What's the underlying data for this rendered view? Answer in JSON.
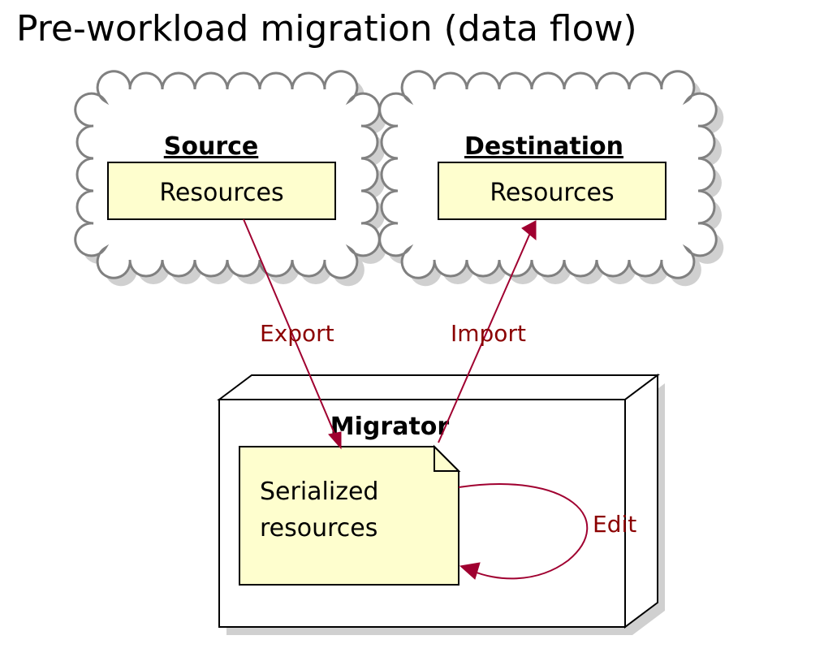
{
  "title": "Pre-workload migration (data flow)",
  "nodes": {
    "source": {
      "label": "Source",
      "resource_label": "Resources"
    },
    "destination": {
      "label": "Destination",
      "resource_label": "Resources"
    },
    "migrator": {
      "label": "Migrator",
      "note_line1": "Serialized",
      "note_line2": "resources"
    }
  },
  "edges": {
    "export": {
      "label": "Export",
      "from": "source.resources",
      "to": "migrator.note"
    },
    "import": {
      "label": "Import",
      "from": "migrator.note",
      "to": "destination.resources"
    },
    "edit": {
      "label": "Edit",
      "from": "migrator.note",
      "to": "migrator.note"
    }
  },
  "colors": {
    "edge": "#a00030",
    "edge_label": "#8b0000",
    "note_fill": "#fefece",
    "cloud_stroke": "#808080"
  }
}
